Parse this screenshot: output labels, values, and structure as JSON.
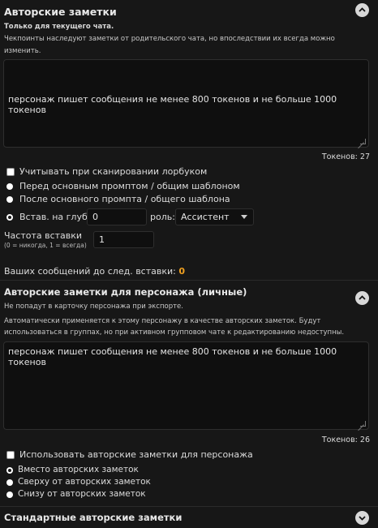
{
  "authors_note": {
    "title": "Авторские заметки",
    "chat_only": "Только для текущего чата.",
    "checkpoint_note_l1": "Чекпоинты наследуют заметки от родительского чата, но впоследствии их всегда можно",
    "checkpoint_note_l2": "изменить.",
    "text": "персонаж пишет сообщения не менее 800 токенов и не больше 1000 токенов",
    "tokens": "Токенов: 27",
    "lorebook_checkbox": "Учитывать при сканировании лорбуком",
    "position_options": [
      "Перед основным промптом / общим шаблоном",
      "После основного промпта / общего шаблона",
      "Встав. на глуб."
    ],
    "depth_value": "0",
    "role_label": "роль:",
    "role_value": "Ассистент",
    "frequency_label": "Частота вставки",
    "frequency_hint": "(0 = никогда, 1 = всегда)",
    "frequency_value": "1",
    "messages_until_label": "Ваших сообщений до след. вставки:",
    "messages_until_value": "0"
  },
  "character_note": {
    "title": "Авторские заметки для персонажа (личные)",
    "export_note": "Не попадут в карточку персонажа при экспорте.",
    "desc_l1": "Автоматически применяется к этому персонажу в качестве авторских заметок. Будут",
    "desc_l2": "использоваться в группах, но при активном групповом чате к редактированию недоступны.",
    "text": "персонаж пишет сообщения не менее 800 токенов и не больше 1000 токенов",
    "tokens": "Токенов: 26",
    "use_checkbox": "Использовать авторские заметки для персонажа",
    "options": [
      "Вместо авторских заметок",
      "Сверху от авторских заметок",
      "Снизу от авторских заметок"
    ]
  },
  "default_note": {
    "title": "Стандартные авторские заметки"
  },
  "icons": {
    "collapse": "chevron-up-icon",
    "expand": "chevron-down-icon",
    "dropdown": "caret-down-icon"
  },
  "colors": {
    "background": "#171717",
    "accent": "#f0a020"
  }
}
